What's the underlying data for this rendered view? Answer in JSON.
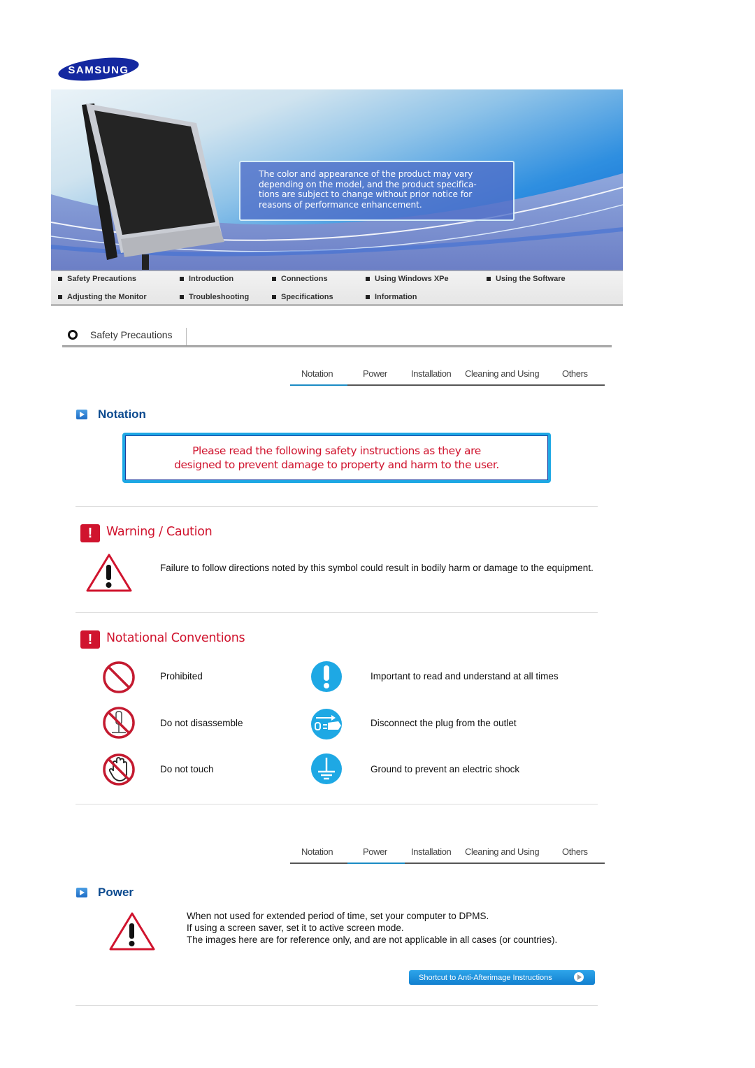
{
  "brand": {
    "logo_text": "SAMSUNG",
    "color": "#1428a0"
  },
  "banner": {
    "note_lines": [
      "The color and appearance of the product may vary",
      "depending on the model, and the product specifica-",
      "tions are subject to change without prior notice for",
      "reasons of performance enhancement."
    ]
  },
  "nav": {
    "row1": [
      "Safety Precautions",
      "Introduction",
      "Connections",
      "Using Windows XPe",
      "Using the Software"
    ],
    "row2": [
      "Adjusting the Monitor",
      "Troubleshooting",
      "Specifications",
      "Information"
    ]
  },
  "page_section": {
    "title": "Safety Precautions"
  },
  "tabs": {
    "items": [
      "Notation",
      "Power",
      "Installation",
      "Cleaning and Using",
      "Others"
    ],
    "accent": "#1a8bc4"
  },
  "notation": {
    "title": "Notation",
    "notice_lines": [
      "Please read the following safety instructions as they are",
      "designed to prevent damage to property and harm to the user."
    ],
    "warning": {
      "heading": "Warning / Caution",
      "text": "Failure to follow directions noted by this symbol could result in bodily harm or damage to the equipment."
    },
    "conventions": {
      "heading": "Notational Conventions",
      "items": [
        {
          "icon": "prohibited-icon",
          "label": "Prohibited"
        },
        {
          "icon": "important-icon",
          "label": "Important to read and understand at all times"
        },
        {
          "icon": "do-not-disassemble-icon",
          "label": "Do not disassemble"
        },
        {
          "icon": "unplug-icon",
          "label": "Disconnect the plug from the outlet"
        },
        {
          "icon": "do-not-touch-icon",
          "label": "Do not touch"
        },
        {
          "icon": "ground-icon",
          "label": "Ground to prevent an electric shock"
        }
      ]
    }
  },
  "power": {
    "title": "Power",
    "lines": [
      "When not used for extended period of time, set your computer to DPMS.",
      "If using a screen saver, set it to active screen mode.",
      "The images here are for reference only, and are not applicable in all cases (or countries)."
    ],
    "shortcut_label": "Shortcut to Anti-Afterimage Instructions"
  },
  "colors": {
    "red": "#d0142e",
    "blue_icon": "#1ea8e4",
    "heading_blue": "#0b4a8f"
  }
}
